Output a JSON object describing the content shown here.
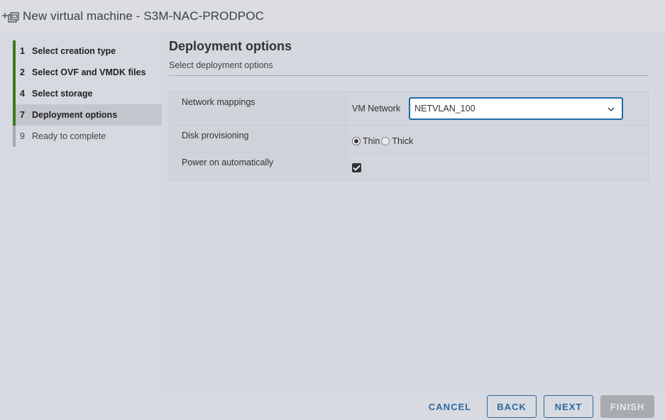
{
  "window": {
    "title": "New virtual machine - S3M-NAC-PRODPOC",
    "title_icon": "new-vm-icon"
  },
  "sidebar": {
    "steps": [
      {
        "num": "1",
        "label": "Select creation type",
        "state": "done"
      },
      {
        "num": "2",
        "label": "Select OVF and VMDK files",
        "state": "done"
      },
      {
        "num": "4",
        "label": "Select storage",
        "state": "done"
      },
      {
        "num": "7",
        "label": "Deployment options",
        "state": "active"
      },
      {
        "num": "9",
        "label": "Ready to complete",
        "state": "pending"
      }
    ]
  },
  "main": {
    "title": "Deployment options",
    "subtitle": "Select deployment options",
    "options": {
      "network": {
        "label": "Network mappings",
        "sub_label": "VM Network",
        "selected": "NETVLAN_100"
      },
      "disk": {
        "label": "Disk provisioning",
        "options": [
          "Thin",
          "Thick"
        ],
        "selected": "Thin"
      },
      "power": {
        "label": "Power on automatically",
        "checked": true
      }
    }
  },
  "footer": {
    "cancel": "CANCEL",
    "back": "BACK",
    "next": "NEXT",
    "finish": "FINISH"
  },
  "colors": {
    "accent": "#2b6aa0",
    "step_done": "#3a7a1a",
    "step_pending": "#a5a7ab"
  }
}
